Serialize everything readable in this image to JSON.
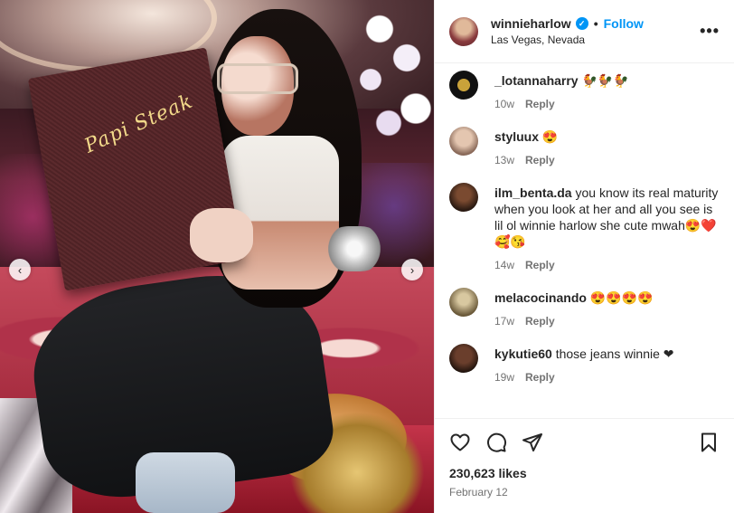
{
  "post": {
    "username": "winnieharlow",
    "verified": true,
    "follow_label": "Follow",
    "separator": "•",
    "location": "Las Vegas, Nevada",
    "more_label": "•••",
    "media_text": "Papi Steak",
    "likes": "230,623 likes",
    "date": "February 12"
  },
  "comments": [
    {
      "username": "_lotannaharry",
      "text": "🐓🐓🐓",
      "time": "10w",
      "reply": "Reply"
    },
    {
      "username": "styluux",
      "text": "😍",
      "time": "13w",
      "reply": "Reply"
    },
    {
      "username": "ilm_benta.da",
      "text": "you know its real maturity when you look at her and all you see is lil ol winnie harlow she cute mwah😍❤️🥰😘",
      "time": "14w",
      "reply": "Reply"
    },
    {
      "username": "melacocinando",
      "text": "😍😍😍😍",
      "time": "17w",
      "reply": "Reply"
    },
    {
      "username": "kykutie60",
      "text": "those jeans winnie ❤",
      "time": "19w",
      "reply": "Reply"
    }
  ],
  "carousel": {
    "prev_icon": "chevron-left-icon",
    "next_icon": "chevron-right-icon",
    "prev_glyph": "‹",
    "next_glyph": "›"
  },
  "colors": {
    "accent": "#0095f6",
    "text": "#262626",
    "muted": "#737373",
    "border": "#efefef"
  }
}
